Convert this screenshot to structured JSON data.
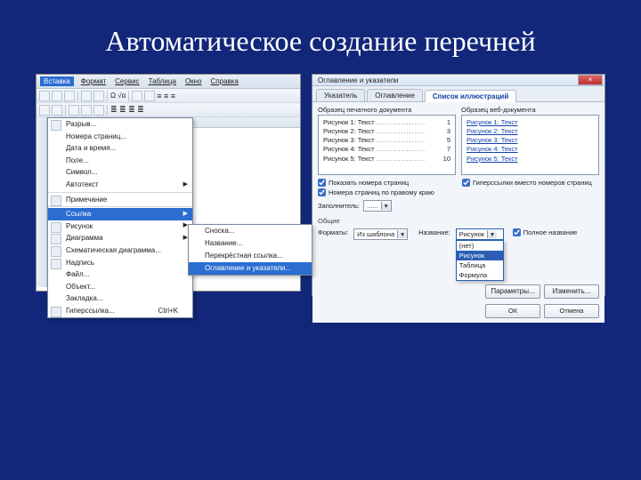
{
  "slide": {
    "title": "Автоматическое создание перечней"
  },
  "left": {
    "menubar": [
      "Вставка",
      "Формат",
      "Сервис",
      "Таблица",
      "Окно",
      "Справка"
    ],
    "active_menu_index": 0,
    "menu": {
      "items": [
        {
          "label": "Разрыв...",
          "icon": true
        },
        {
          "label": "Номера страниц..."
        },
        {
          "label": "Дата и время..."
        },
        {
          "label": "Поле..."
        },
        {
          "label": "Символ..."
        },
        {
          "label": "Автотекст",
          "arrow": true
        },
        {
          "sep": true
        },
        {
          "label": "Примечание",
          "icon": true
        },
        {
          "sep": true
        },
        {
          "label": "Ссылка",
          "arrow": true,
          "open": true
        },
        {
          "label": "Рисунок",
          "arrow": true,
          "icon": true
        },
        {
          "label": "Диаграмма",
          "arrow": true,
          "icon": true
        },
        {
          "label": "Схематическая диаграмма...",
          "icon": true
        },
        {
          "label": "Надпись",
          "icon": true
        },
        {
          "label": "Файл..."
        },
        {
          "label": "Объект..."
        },
        {
          "label": "Закладка..."
        },
        {
          "label": "Гиперссылка...",
          "hotkey": "Ctrl+K",
          "icon": true
        }
      ],
      "submenu": [
        "Сноска...",
        "Название...",
        "Перекрёстная ссылка...",
        "Оглавление и указатели..."
      ],
      "submenu_hi_index": 3
    }
  },
  "right": {
    "title": "Оглавление и указатели",
    "tabs": [
      "Указатель",
      "Оглавление",
      "Список иллюстраций"
    ],
    "active_tab": 2,
    "preview_print_label": "Образец печатного документа",
    "preview_web_label": "Образец веб-документа",
    "print_lines": [
      {
        "t": "Рисунок 1: Текст",
        "p": "1"
      },
      {
        "t": "Рисунок 2: Текст",
        "p": "3"
      },
      {
        "t": "Рисунок 3: Текст",
        "p": "5"
      },
      {
        "t": "Рисунок 4: Текст",
        "p": "7"
      },
      {
        "t": "Рисунок 5: Текст",
        "p": "10"
      }
    ],
    "web_lines": [
      "Рисунок 1: Текст",
      "Рисунок 2: Текст",
      "Рисунок 3: Текст",
      "Рисунок 4: Текст",
      "Рисунок 5: Текст"
    ],
    "checks": {
      "show_pn": "Показать номера страниц",
      "right_align": "Номера страниц по правому краю",
      "hyperlinks": "Гиперссылки вместо номеров страниц"
    },
    "filler_label": "Заполнитель:",
    "filler_value": "......",
    "group_label": "Общие",
    "format_label": "Форматы:",
    "format_value": "Из шаблона",
    "caption_label": "Название:",
    "caption_value": "Рисунок",
    "full_caption": "Полное название",
    "dropdown_options": [
      "(нет)",
      "Рисунок",
      "Таблица",
      "Формула"
    ],
    "dropdown_selected": "Рисунок",
    "btn_params": "Параметры...",
    "btn_modify": "Изменить...",
    "btn_ok": "ОК",
    "btn_cancel": "Отмена",
    "win_close": "×"
  }
}
